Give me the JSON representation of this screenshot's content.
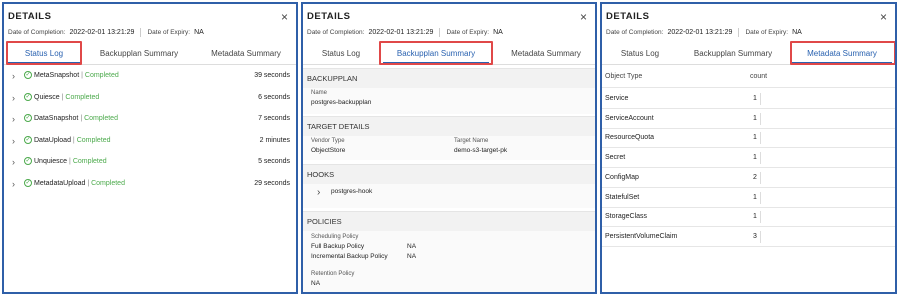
{
  "common": {
    "title": "DETAILS",
    "close_glyph": "×",
    "completion_label": "Date of Completion:",
    "completion_value": "2022-02-01 13:21:29",
    "expiry_label": "Date of Expiry:",
    "expiry_value": "NA",
    "tabs": [
      "Status Log",
      "Backupplan Summary",
      "Metadata Summary"
    ]
  },
  "colors": {
    "accent": "#2a62b0",
    "highlight": "#e04848",
    "success": "#4caa4c",
    "border": "#2f5fa8"
  },
  "status_log": {
    "chevron": "›",
    "check": "✓",
    "separator": "|",
    "items": [
      {
        "name": "MetaSnapshot",
        "status": "Completed",
        "duration": "39 seconds"
      },
      {
        "name": "Quiesce",
        "status": "Completed",
        "duration": "6 seconds"
      },
      {
        "name": "DataSnapshot",
        "status": "Completed",
        "duration": "7 seconds"
      },
      {
        "name": "DataUpload",
        "status": "Completed",
        "duration": "2 minutes"
      },
      {
        "name": "Unquiesce",
        "status": "Completed",
        "duration": "5 seconds"
      },
      {
        "name": "MetadataUpload",
        "status": "Completed",
        "duration": "29 seconds"
      }
    ]
  },
  "backupplan_summary": {
    "backupplan": {
      "heading": "BACKUPPLAN",
      "name_label": "Name",
      "name_value": "postgres-backupplan"
    },
    "target": {
      "heading": "TARGET DETAILS",
      "vendor_label": "Vendor Type",
      "vendor_value": "ObjectStore",
      "target_label": "Target Name",
      "target_value": "demo-s3-target-pk"
    },
    "hooks": {
      "heading": "HOOKS",
      "chevron": "›",
      "item": "postgres-hook"
    },
    "policies": {
      "heading": "POLICIES",
      "scheduling_label": "Scheduling Policy",
      "full_label": "Full Backup Policy",
      "full_value": "NA",
      "incremental_label": "Incremental Backup Policy",
      "incremental_value": "NA",
      "retention_label": "Retention Policy",
      "retention_value": "NA"
    }
  },
  "metadata_summary": {
    "header": {
      "type": "Object Type",
      "count": "count"
    },
    "rows": [
      {
        "type": "Service",
        "count": "1"
      },
      {
        "type": "ServiceAccount",
        "count": "1"
      },
      {
        "type": "ResourceQuota",
        "count": "1"
      },
      {
        "type": "Secret",
        "count": "1"
      },
      {
        "type": "ConfigMap",
        "count": "2"
      },
      {
        "type": "StatefulSet",
        "count": "1"
      },
      {
        "type": "StorageClass",
        "count": "1"
      },
      {
        "type": "PersistentVolumeClaim",
        "count": "3"
      }
    ]
  }
}
